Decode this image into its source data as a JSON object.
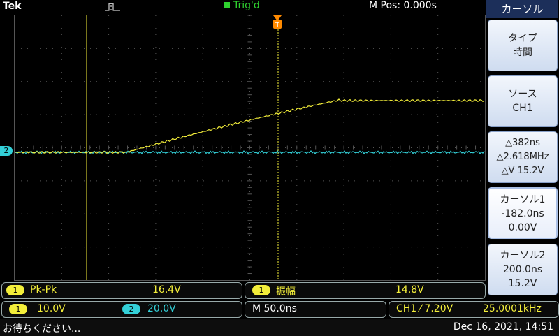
{
  "top": {
    "brand": "Tek",
    "trigger_status": "Trig'd",
    "m_pos": "M Pos: 0.000s"
  },
  "channel2_marker": "2",
  "side": {
    "title": "カーソル",
    "buttons": [
      {
        "l1": "タイプ",
        "l2": "時間"
      },
      {
        "l1": "ソース",
        "l2": "CH1"
      },
      {
        "l1": "△382ns",
        "l2": "△2.618MHz",
        "l3": "△V 15.2V"
      },
      {
        "l1": "カーソル1",
        "l2": "-182.0ns",
        "l3": "0.00V"
      },
      {
        "l1": "カーソル2",
        "l2": "200.0ns",
        "l3": "15.2V"
      }
    ]
  },
  "measurements": [
    {
      "ch": "1",
      "label": "Pk-Pk",
      "value": "16.4V"
    },
    {
      "ch": "1",
      "label": "振幅",
      "value": "14.8V"
    }
  ],
  "bottom": {
    "ch1_scale_badge": "1",
    "ch1_scale": "10.0V",
    "ch2_scale_badge": "2",
    "ch2_scale": "20.0V",
    "timebase": "M 50.0ns",
    "trigger_info": "CH1 ⁄ 7.20V",
    "frequency": "25.0001kHz"
  },
  "status": {
    "message": "お待ちください...",
    "datetime": "Dec 16, 2021, 14:51"
  },
  "colors": {
    "ch1": "#f3ee3a",
    "ch2": "#33d0d8",
    "trigger": "#2fd12f",
    "trigger_pos": "#ff8a00"
  }
}
